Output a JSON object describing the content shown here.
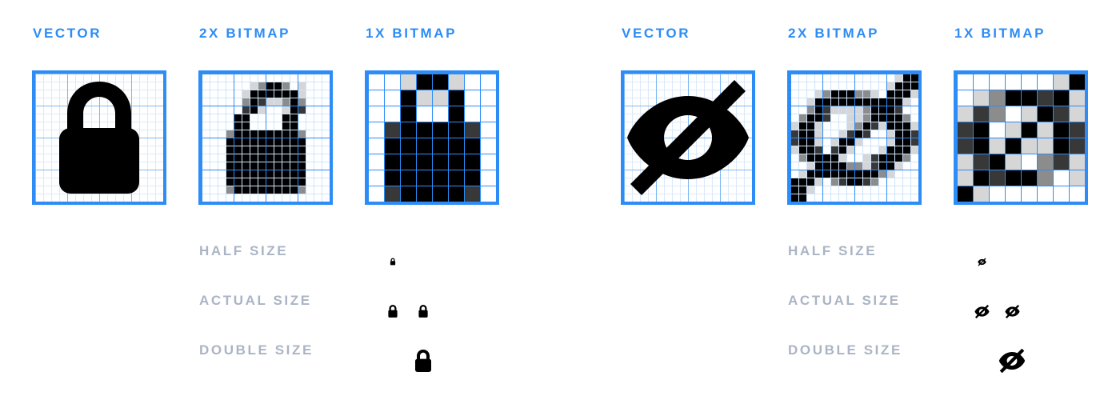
{
  "theme": {
    "accent_blue": "#2d8cf5",
    "grid_light": "#dce9f8",
    "grid_mid": "#7cb9f7",
    "label_gray": "#aab4c4",
    "ink": "#000000",
    "background": "#ffffff"
  },
  "groups": [
    {
      "id": "lock",
      "icon_name": "lock-icon",
      "columns": [
        {
          "id": "vector",
          "heading": "VECTOR"
        },
        {
          "id": "bitmap-2x",
          "heading": "2X BITMAP"
        },
        {
          "id": "bitmap-1x",
          "heading": "1X BITMAP"
        }
      ],
      "size_rows": [
        {
          "id": "half",
          "label": "HALF SIZE",
          "samples": [
            {
              "col": 1,
              "scale": 0.5
            }
          ]
        },
        {
          "id": "actual",
          "label": "ACTUAL SIZE",
          "samples": [
            {
              "col": 1,
              "scale": 1
            },
            {
              "col": 2,
              "scale": 1
            }
          ]
        },
        {
          "id": "double",
          "label": "DOUBLE SIZE",
          "samples": [
            {
              "col": 2,
              "scale": 2
            }
          ]
        }
      ]
    },
    {
      "id": "eyeoff",
      "icon_name": "eye-off-icon",
      "columns": [
        {
          "id": "vector",
          "heading": "VECTOR"
        },
        {
          "id": "bitmap-2x",
          "heading": "2X BITMAP"
        },
        {
          "id": "bitmap-1x",
          "heading": "1X BITMAP"
        }
      ],
      "size_rows": [
        {
          "id": "half",
          "label": "HALF SIZE",
          "samples": [
            {
              "col": 1,
              "scale": 0.5
            }
          ]
        },
        {
          "id": "actual",
          "label": "ACTUAL SIZE",
          "samples": [
            {
              "col": 1,
              "scale": 1
            },
            {
              "col": 2,
              "scale": 1
            }
          ]
        },
        {
          "id": "double",
          "label": "DOUBLE SIZE",
          "samples": [
            {
              "col": 2,
              "scale": 2
            }
          ]
        }
      ]
    }
  ],
  "grids": {
    "vector_cells": 16,
    "bitmap_2x_cells": 16,
    "bitmap_1x_cells": 8
  }
}
